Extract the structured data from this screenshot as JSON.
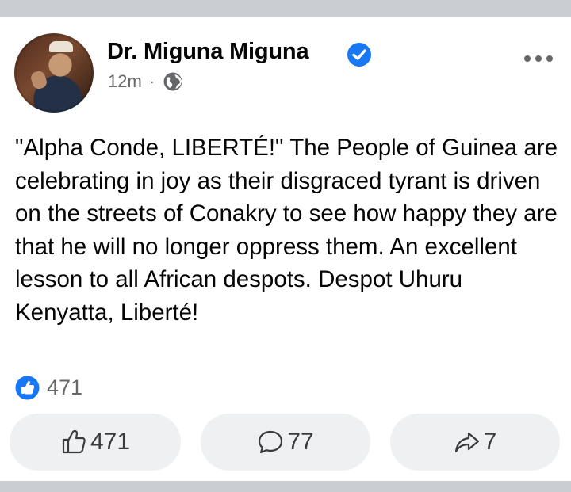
{
  "post": {
    "author": "Dr. Miguna Miguna",
    "timestamp": "12m",
    "separator": "·",
    "text": "\"Alpha Conde, LIBERTÉ!\" The People of Guinea are celebrating in joy as their disgraced tyrant is driven on the streets of Conakry to see how happy they are that he will no longer oppress them. An excellent lesson to all African despots. Despot Uhuru Kenyatta, Liberté!",
    "reaction_count": "471"
  },
  "actions": {
    "like_count": "471",
    "comment_count": "77",
    "share_count": "7"
  },
  "icons": {
    "verified": "verified-badge-icon",
    "audience": "globe-icon",
    "more": "more-options-icon",
    "reaction": "like-reaction-icon",
    "like": "thumbs-up-icon",
    "comment": "comment-icon",
    "share": "share-icon"
  },
  "colors": {
    "brand_blue": "#1877f2",
    "secondary_text": "#65676b",
    "button_bg": "#eef0f2"
  }
}
